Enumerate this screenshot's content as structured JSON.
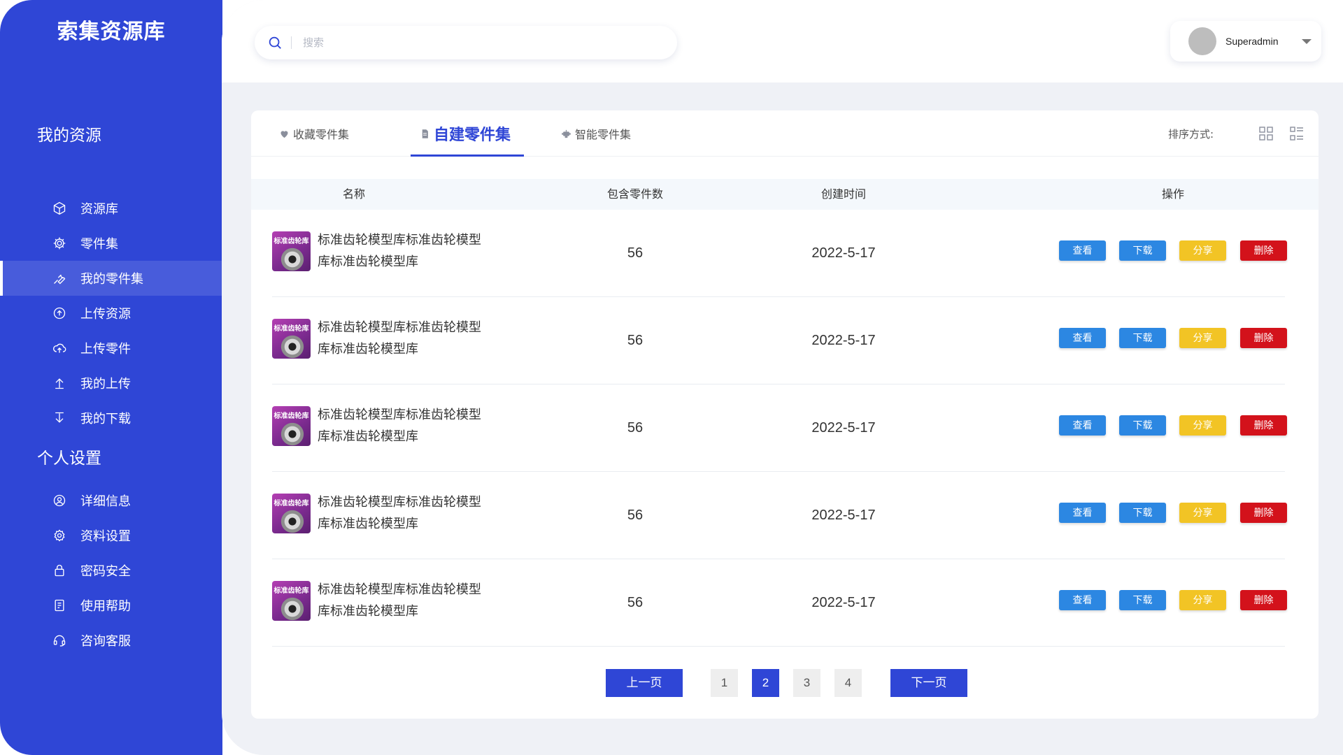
{
  "app": {
    "brand": "索集资源库"
  },
  "sidebar": {
    "section1_title": "我的资源",
    "section1_items": [
      {
        "label": "资源库",
        "icon": "cube-icon"
      },
      {
        "label": "零件集",
        "icon": "gear-icon"
      },
      {
        "label": "我的零件集",
        "icon": "wrench-icon",
        "active": true
      },
      {
        "label": "上传资源",
        "icon": "upload-circle-icon"
      },
      {
        "label": "上传零件",
        "icon": "cloud-upload-icon"
      },
      {
        "label": "我的上传",
        "icon": "arrow-up-icon"
      },
      {
        "label": "我的下载",
        "icon": "arrow-down-icon"
      }
    ],
    "section2_title": "个人设置",
    "section2_items": [
      {
        "label": "详细信息",
        "icon": "user-circle-icon"
      },
      {
        "label": "资料设置",
        "icon": "settings-icon"
      },
      {
        "label": "密码安全",
        "icon": "lock-icon"
      },
      {
        "label": "使用帮助",
        "icon": "document-icon"
      },
      {
        "label": "咨询客服",
        "icon": "headset-icon"
      }
    ]
  },
  "header": {
    "search_placeholder": "搜索",
    "username": "Superadmin"
  },
  "tabs": [
    {
      "label": "收藏零件集",
      "icon": "heart-icon"
    },
    {
      "label": "自建零件集",
      "icon": "file-icon",
      "active": true
    },
    {
      "label": "智能零件集",
      "icon": "robot-icon"
    }
  ],
  "sort_label": "排序方式:",
  "table": {
    "columns": [
      "名称",
      "包含零件数",
      "创建时间",
      "操作"
    ],
    "rows": [
      {
        "thumb_text": "标准齿轮库",
        "name": "标准齿轮模型库标准齿轮模型库标准齿轮模型库",
        "count": "56",
        "date": "2022-5-17"
      },
      {
        "thumb_text": "标准齿轮库",
        "name": "标准齿轮模型库标准齿轮模型库标准齿轮模型库",
        "count": "56",
        "date": "2022-5-17"
      },
      {
        "thumb_text": "标准齿轮库",
        "name": "标准齿轮模型库标准齿轮模型库标准齿轮模型库",
        "count": "56",
        "date": "2022-5-17"
      },
      {
        "thumb_text": "标准齿轮库",
        "name": "标准齿轮模型库标准齿轮模型库标准齿轮模型库",
        "count": "56",
        "date": "2022-5-17"
      },
      {
        "thumb_text": "标准齿轮库",
        "name": "标准齿轮模型库标准齿轮模型库标准齿轮模型库",
        "count": "56",
        "date": "2022-5-17"
      }
    ],
    "actions": {
      "view": "查看",
      "download": "下载",
      "share": "分享",
      "delete": "删除"
    }
  },
  "pagination": {
    "prev": "上一页",
    "next": "下一页",
    "pages": [
      "1",
      "2",
      "3",
      "4"
    ],
    "current": "2"
  },
  "colors": {
    "primary": "#2f46d6",
    "action_blue": "#2c87e2",
    "action_yellow": "#f2c425",
    "action_red": "#d3121b"
  }
}
